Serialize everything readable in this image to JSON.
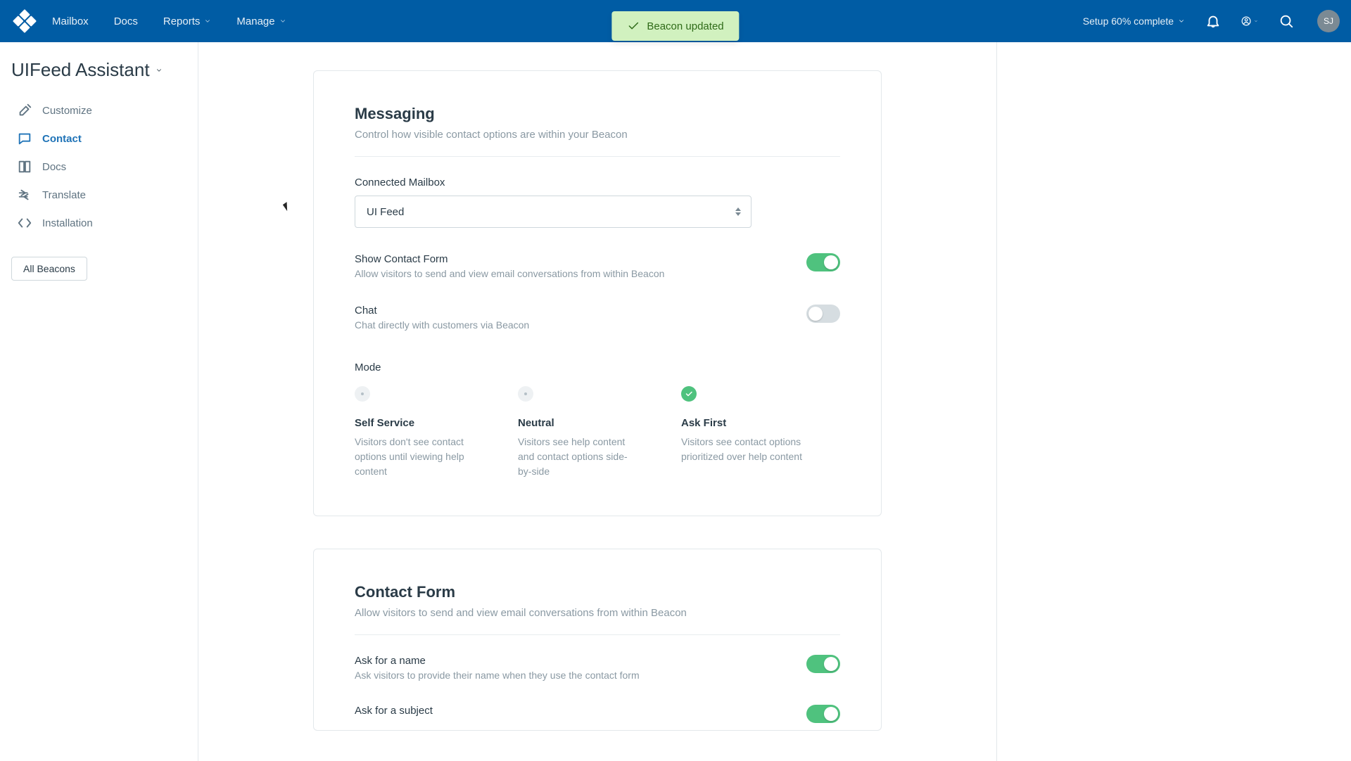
{
  "topnav": {
    "items": [
      "Mailbox",
      "Docs",
      "Reports",
      "Manage"
    ],
    "setup": "Setup 60% complete",
    "avatar": "SJ"
  },
  "toast": {
    "message": "Beacon updated"
  },
  "sidebar": {
    "title": "UIFeed Assistant",
    "items": [
      {
        "label": "Customize"
      },
      {
        "label": "Contact"
      },
      {
        "label": "Docs"
      },
      {
        "label": "Translate"
      },
      {
        "label": "Installation"
      }
    ],
    "all_button": "All Beacons"
  },
  "messaging": {
    "heading": "Messaging",
    "sub": "Control how visible contact options are within your Beacon",
    "connected_label": "Connected Mailbox",
    "connected_value": "UI Feed",
    "show_contact": {
      "title": "Show Contact Form",
      "desc": "Allow visitors to send and view email conversations from within Beacon",
      "on": true
    },
    "chat": {
      "title": "Chat",
      "desc": "Chat directly with customers via Beacon",
      "on": false
    },
    "mode_label": "Mode",
    "modes": [
      {
        "title": "Self Service",
        "desc": "Visitors don't see contact options until viewing help content",
        "selected": false
      },
      {
        "title": "Neutral",
        "desc": "Visitors see help content and contact options side-by-side",
        "selected": false
      },
      {
        "title": "Ask First",
        "desc": "Visitors see contact options prioritized over help content",
        "selected": true
      }
    ]
  },
  "contact_form": {
    "heading": "Contact Form",
    "sub": "Allow visitors to send and view email conversations from within Beacon",
    "ask_name": {
      "title": "Ask for a name",
      "desc": "Ask visitors to provide their name when they use the contact form",
      "on": true
    },
    "ask_subject": {
      "title": "Ask for a subject",
      "on": true
    }
  }
}
